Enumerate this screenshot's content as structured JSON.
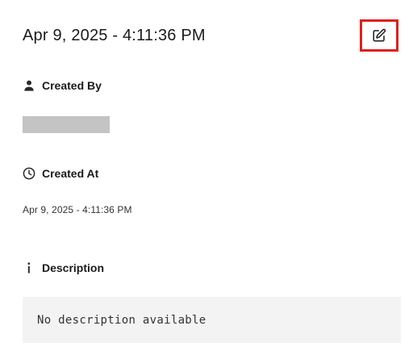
{
  "header": {
    "title": "Apr 9, 2025 - 4:11:36 PM",
    "edit_icon": "edit-icon",
    "highlight_color": "#e0201b"
  },
  "created_by": {
    "label": "Created By",
    "icon": "person-icon",
    "redacted_color": "#c4c4c4"
  },
  "created_at": {
    "label": "Created At",
    "icon": "clock-icon",
    "value": "Apr 9, 2025 - 4:11:36 PM"
  },
  "description": {
    "label": "Description",
    "icon": "info-icon",
    "text": "No description available",
    "box_color": "#f3f3f3"
  }
}
